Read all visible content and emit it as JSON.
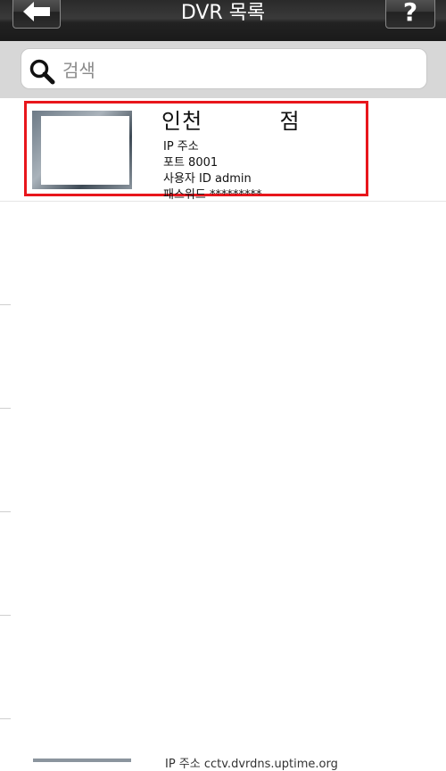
{
  "header": {
    "title": "DVR 목록",
    "help_label": "?"
  },
  "search": {
    "placeholder": "검색",
    "value": ""
  },
  "list": {
    "items": [
      {
        "name": "인천          점",
        "ip_label": "IP 주소",
        "port_label": "포트 8001",
        "user_label": "사용자 ID admin",
        "password_label": "패스워드 *********"
      }
    ],
    "partial_item_text": "IP 주소 cctv.dvrdns.uptime.org"
  }
}
